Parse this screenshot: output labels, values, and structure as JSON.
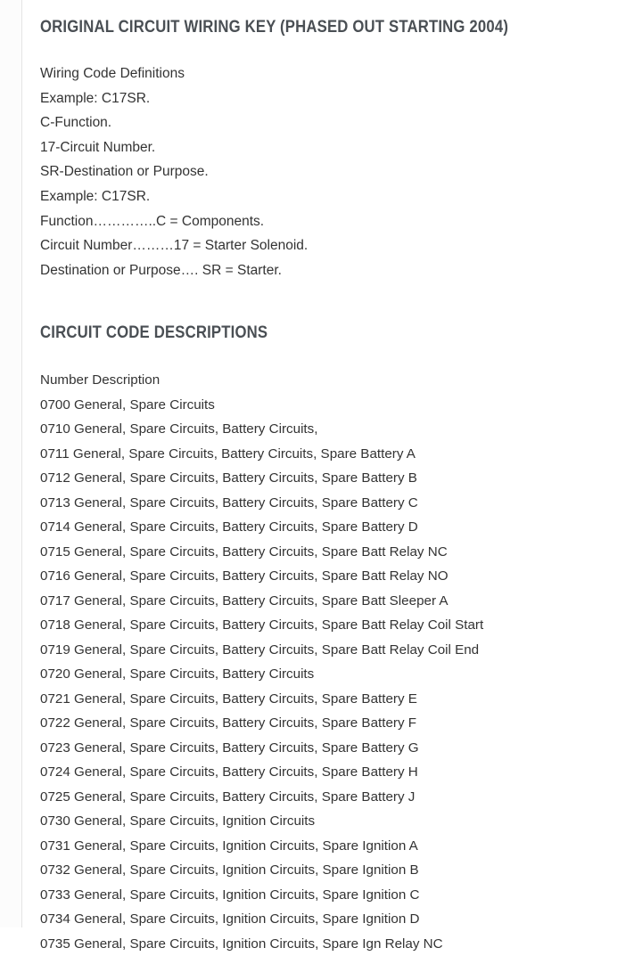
{
  "document": {
    "heading_1": "ORIGINAL CIRCUIT WIRING KEY (PHASED OUT STARTING 2004)",
    "heading_2": "CIRCUIT CODE DESCRIPTIONS",
    "definitions": [
      "Wiring Code Definitions",
      "Example: C17SR.",
      "C-Function.",
      "17-Circuit Number.",
      "SR-Destination or Purpose.",
      "Example: C17SR.",
      "Function…………..C = Components.",
      "Circuit Number………17 = Starter Solenoid.",
      "Destination or Purpose…. SR = Starter."
    ],
    "list_header": "Number Description",
    "codes": [
      "0700 General, Spare Circuits",
      "0710 General, Spare Circuits, Battery Circuits,",
      "0711 General, Spare Circuits, Battery Circuits, Spare Battery A",
      "0712 General, Spare Circuits, Battery Circuits, Spare Battery B",
      "0713 General, Spare Circuits, Battery Circuits, Spare Battery C",
      "0714 General, Spare Circuits, Battery Circuits, Spare Battery D",
      "0715 General, Spare Circuits, Battery Circuits, Spare Batt Relay NC",
      "0716 General, Spare Circuits, Battery Circuits, Spare Batt Relay NO",
      "0717 General, Spare Circuits, Battery Circuits, Spare Batt Sleeper A",
      "0718 General, Spare Circuits, Battery Circuits, Spare Batt Relay Coil Start",
      "0719 General, Spare Circuits, Battery Circuits, Spare Batt Relay Coil End",
      "0720 General, Spare Circuits, Battery Circuits",
      "0721 General, Spare Circuits, Battery Circuits, Spare Battery E",
      "0722 General, Spare Circuits, Battery Circuits, Spare Battery F",
      "0723 General, Spare Circuits, Battery Circuits, Spare Battery G",
      "0724 General, Spare Circuits, Battery Circuits, Spare Battery H",
      "0725 General, Spare Circuits, Battery Circuits, Spare Battery J",
      "0730 General, Spare Circuits, Ignition Circuits",
      "0731 General, Spare Circuits, Ignition Circuits, Spare Ignition A",
      "0732 General, Spare Circuits, Ignition Circuits, Spare Ignition B",
      "0733 General, Spare Circuits, Ignition Circuits, Spare Ignition C",
      "0734 General, Spare Circuits, Ignition Circuits, Spare Ignition D",
      "0735 General, Spare Circuits, Ignition Circuits, Spare Ign Relay NC"
    ]
  },
  "colors": {
    "heading": "#4a4f54",
    "body_text": "#333333",
    "gutter_rule": "#e4e4e4",
    "background": "#ffffff"
  }
}
